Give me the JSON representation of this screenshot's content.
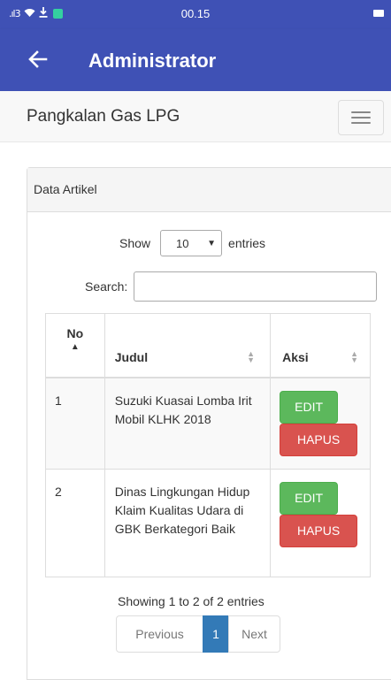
{
  "status_bar": {
    "signal": ".ıl3",
    "time": "00.15"
  },
  "app_bar": {
    "back_icon": "arrow-left-icon",
    "title": "Administrator"
  },
  "navbar": {
    "brand": "Pangkalan Gas LPG",
    "menu_icon": "hamburger-menu-icon"
  },
  "panel": {
    "heading": "Data Artikel",
    "length": {
      "label_before": "Show",
      "selected": "10",
      "label_after": "entries"
    },
    "search": {
      "label": "Search:",
      "value": "",
      "placeholder": ""
    },
    "table": {
      "columns": [
        "No",
        "Judul",
        "Aksi"
      ],
      "rows": [
        {
          "no": "1",
          "judul": "Suzuki Kuasai Lomba Irit Mobil KLHK 2018",
          "edit_label": "EDIT",
          "hapus_label": "HAPUS"
        },
        {
          "no": "2",
          "judul": "Dinas Lingkungan Hidup Klaim Kualitas Udara di GBK Berkategori Baik",
          "edit_label": "EDIT",
          "hapus_label": "HAPUS"
        }
      ]
    },
    "info": "Showing 1 to 2 of 2 entries",
    "pagination": {
      "previous": "Previous",
      "current": "1",
      "next": "Next"
    }
  },
  "colors": {
    "primary": "#3F51B5",
    "edit": "#5cb85c",
    "delete": "#d9534f",
    "page_active": "#337ab7"
  }
}
